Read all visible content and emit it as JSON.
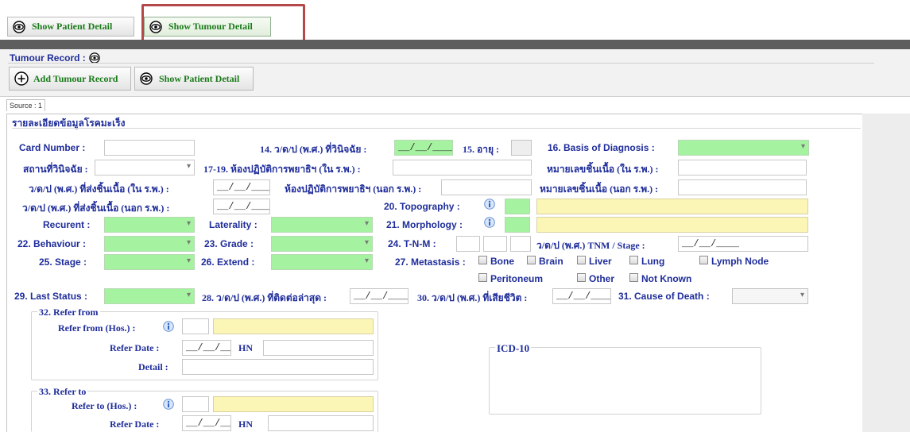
{
  "topbar": {
    "show_patient_detail": "Show Patient Detail",
    "show_tumour_detail": "Show Tumour Detail"
  },
  "tumour_record": {
    "title": "Tumour Record :",
    "add_tumour_record": "Add Tumour Record",
    "show_patient_detail": "Show Patient Detail"
  },
  "source_tab": "Source : 1",
  "form": {
    "section_title": "รายละเอียดข้อมูลโรคมะเร็ง",
    "card_number": "Card Number :",
    "diag_date": "14. ว/ด/ป (พ.ศ.) ที่วินิจฉัย :",
    "age": "15. อายุ :",
    "basis_of_diagnosis": "16. Basis of Diagnosis :",
    "place_of_diagnosis": "สถานที่วินิจฉัย :",
    "pathology_lab_in": "17-19. ห้องปฏิบัติการพยาธิฯ (ใน ร.พ.) :",
    "specimen_no_in": "หมายเลขชิ้นเนื้อ (ใน ร.พ.) :",
    "date_sent_in": "ว/ด/ป (พ.ศ.) ที่ส่งชิ้นเนื้อ (ใน ร.พ.) :",
    "pathology_lab_out": "ห้องปฏิบัติการพยาธิฯ (นอก ร.พ.) :",
    "specimen_no_out": "หมายเลขชิ้นเนื้อ (นอก ร.พ.) :",
    "date_sent_out": "ว/ด/ป (พ.ศ.) ที่ส่งชิ้นเนื้อ (นอก ร.พ.) :",
    "topography": "20. Topography :",
    "recurent": "Recurent :",
    "laterality": "Laterality :",
    "morphology": "21. Morphology :",
    "behaviour": "22. Behaviour :",
    "grade": "23. Grade :",
    "tnm": "24. T-N-M :",
    "tnm_stage_date": "ว/ด/ป (พ.ศ.) TNM / Stage :",
    "stage": "25. Stage :",
    "extend": "26. Extend :",
    "metastasis": "27. Metastasis :",
    "meta_bone": "Bone",
    "meta_brain": "Brain",
    "meta_liver": "Liver",
    "meta_lung": "Lung",
    "meta_lymph": "Lymph Node",
    "meta_peritoneum": "Peritoneum",
    "meta_other": "Other",
    "meta_not_known": "Not Known",
    "last_status": "29. Last Status :",
    "last_contact": "28. ว/ด/ป (พ.ศ.) ที่ติดต่อล่าสุด :",
    "date_of_death": "30. ว/ด/ป (พ.ศ.) ที่เสียชีวิต :",
    "cause_of_death": "31. Cause of Death :",
    "date_placeholder": "__/__/____"
  },
  "refer_from": {
    "title": "32. Refer from",
    "hos": "Refer from (Hos.) :",
    "date": "Refer Date :",
    "hn": "HN",
    "detail": "Detail :"
  },
  "refer_to": {
    "title": "33. Refer to",
    "hos": "Refer to (Hos.) :",
    "date": "Refer Date :",
    "hn": "HN"
  },
  "icd10": {
    "title": "ICD-10"
  },
  "colors": {
    "label_blue": "#1f2d9a",
    "green_field": "#a5f2a0",
    "yellow_field": "#fbf6b6",
    "highlight_red": "#b5484a",
    "button_green": "#1a7a1a"
  },
  "icons": [
    "eye-icon",
    "plus-circle-icon",
    "info-icon",
    "dropdown-arrow-icon"
  ]
}
